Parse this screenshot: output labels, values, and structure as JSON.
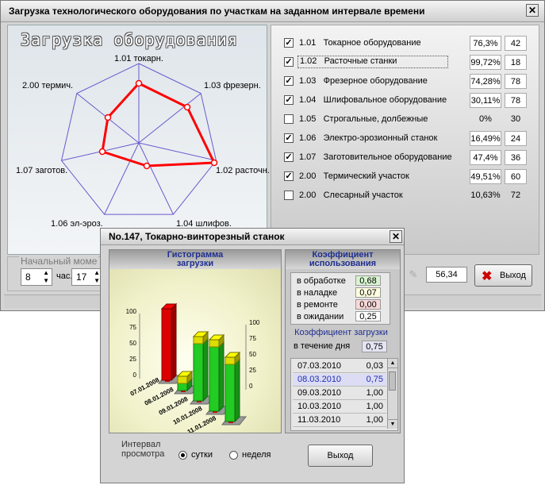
{
  "main": {
    "title": "Загрузка технологического оборудования по участкам на заданном интервале времени",
    "close": "✕",
    "heading": "Загрузка оборудования",
    "radar_axes": [
      "1.01 токарн.",
      "1.03 фрезерн.",
      "1.02 расточн.",
      "1.04 шлифов.",
      "1.06 эл-эроз.",
      "1.07 заготов.",
      "2.00 термич."
    ],
    "start_label": "Начальный моме",
    "hour_value": "8",
    "hour_unit": "час.",
    "minute_value": "17",
    "bottom_value": "56,34",
    "exit_label": "Выход",
    "exit_icon": "red-x-icon",
    "colors": {
      "radar_line": "#ff0000",
      "radar_grid": "#6a5acd",
      "exit_icon": "#cc0000"
    }
  },
  "equipment": [
    {
      "code": "1.01",
      "name": "Токарное оборудование",
      "pct": "76,3%",
      "count": "42",
      "checked": true
    },
    {
      "code": "1.02",
      "name": "Расточные станки",
      "pct": "99,72%",
      "count": "18",
      "checked": true
    },
    {
      "code": "1.03",
      "name": "Фрезерное оборудование",
      "pct": "74,28%",
      "count": "78",
      "checked": true
    },
    {
      "code": "1.04",
      "name": "Шлифовальное оборудование",
      "pct": "30,11%",
      "count": "78",
      "checked": true
    },
    {
      "code": "1.05",
      "name": "Строгальные, долбежные",
      "pct": "0%",
      "count": "30",
      "checked": false
    },
    {
      "code": "1.06",
      "name": "Электро-эрозионный станок",
      "pct": "16,49%",
      "count": "24",
      "checked": true
    },
    {
      "code": "1.07",
      "name": "Заготовительное оборудование",
      "pct": "47,4%",
      "count": "36",
      "checked": true
    },
    {
      "code": "2.00",
      "name": "Термический участок",
      "pct": "49,51%",
      "count": "60",
      "checked": true
    },
    {
      "code": "2.00",
      "name": "Слесарный участок",
      "pct": "10,63%",
      "count": "72",
      "checked": false
    }
  ],
  "dialog": {
    "title": "No.147,  Токарно-винторезный станок",
    "close": "✕",
    "histogram_title_1": "Гистограмма",
    "histogram_title_2": "загрузки",
    "coef_title_1": "Коэффициент",
    "coef_title_2": "использования",
    "coefficients": [
      {
        "label": "в обработке",
        "value": "0,68",
        "color": "#d8f5d0"
      },
      {
        "label": "в наладке",
        "value": "0,07",
        "color": "#ffffe0"
      },
      {
        "label": "в ремонте",
        "value": "0,00",
        "color": "#f8d8d8"
      },
      {
        "label": "в ожидании",
        "value": "0,25",
        "color": "#ffffff"
      }
    ],
    "load_title": "Коэффициент загрузки",
    "day_label": "в течение дня",
    "day_value": "0,75",
    "daily": [
      {
        "date": "07.03.2010",
        "value": "0,03",
        "selected": false
      },
      {
        "date": "08.03.2010",
        "value": "0,75",
        "selected": true
      },
      {
        "date": "09.03.2010",
        "value": "1,00",
        "selected": false
      },
      {
        "date": "10.03.2010",
        "value": "1,00",
        "selected": false
      },
      {
        "date": "11.03.2010",
        "value": "1,00",
        "selected": false
      }
    ],
    "interval_label_1": "Интервал",
    "interval_label_2": "просмотра",
    "option_day": "сутки",
    "option_week": "неделя",
    "exit_label": "Выход"
  },
  "chart_data": {
    "type": "bar",
    "categories": [
      "07.01.2008",
      "08.01.2008",
      "09.01.2008",
      "10.01.2008",
      "11.01.2008"
    ],
    "series": [
      {
        "values": [
          100,
          0,
          0,
          0,
          0
        ],
        "color": "#dd0000"
      },
      {
        "values": [
          0,
          10,
          80,
          90,
          80
        ],
        "color": "#22cc22"
      },
      {
        "values": [
          0,
          10,
          10,
          10,
          10
        ],
        "color": "#dddd00"
      }
    ],
    "yticks": [
      "0",
      "25",
      "50",
      "75",
      "100"
    ],
    "ylim": [
      0,
      100
    ]
  }
}
